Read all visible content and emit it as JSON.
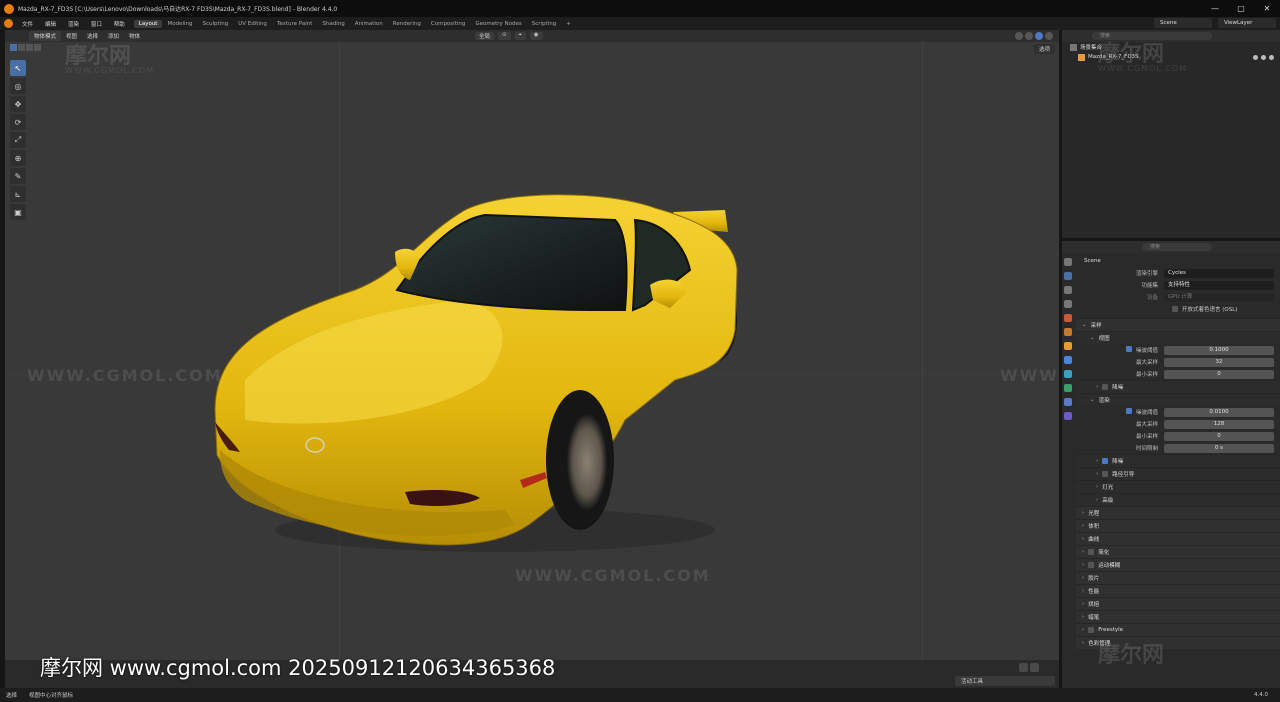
{
  "window": {
    "title": "Mazda_RX-7_FD3S [C:\\Users\\Lenovo\\Downloads\\马自达RX-7 FD3S\\Mazda_RX-7_FD3S.blend] - Blender 4.4.0",
    "min": "—",
    "max": "▢",
    "close": "✕"
  },
  "menu": [
    "文件",
    "编辑",
    "渲染",
    "窗口",
    "帮助"
  ],
  "workspaces": [
    "Layout",
    "Modeling",
    "Sculpting",
    "UV Editing",
    "Texture Paint",
    "Shading",
    "Animation",
    "Rendering",
    "Compositing",
    "Geometry Nodes",
    "Scripting",
    "+"
  ],
  "topright": {
    "scene": "Scene",
    "view_layer": "ViewLayer"
  },
  "viewport": {
    "mode": "物体模式",
    "menus": [
      "视图",
      "选择",
      "添加",
      "物体"
    ],
    "transform": "全局",
    "view_options": "选项"
  },
  "tools": [
    "↖",
    "◎",
    "✥",
    "⟳",
    "⤢",
    "⊕",
    "✎",
    "⊾",
    "▣"
  ],
  "watermarks": {
    "cn": "摩尔网",
    "url": "WWW.CGMOL.COM"
  },
  "overlay_text": "摩尔网 www.cgmol.com 20250912120634365368",
  "timeline": {
    "active_tool": "活动工具"
  },
  "status": {
    "select": "选择",
    "center": "视图中心对齐鼠标",
    "version": "4.4.0"
  },
  "outliner": {
    "search": "搜索",
    "collection": "场景集合",
    "object": "Mazda_RX-7_FD3S"
  },
  "properties": {
    "search": "搜索",
    "scene": "Scene",
    "render_engine_label": "渲染引擎",
    "render_engine": "Cycles",
    "feature_set_label": "功能集",
    "feature_set": "支持特性",
    "device_label": "设备",
    "device": "GPU 计算",
    "osl": "开放式着色语言 (OSL)",
    "sampling": "采样",
    "viewport": "视图",
    "noise_threshold_label": "噪波阈值",
    "vp_noise": "0.1000",
    "max_samples_label": "最大采样",
    "vp_max": "32",
    "min_samples_label": "最小采样",
    "vp_min": "0",
    "denoise": "降噪",
    "render": "渲染",
    "r_noise": "0.0100",
    "r_max": "128",
    "r_min": "0",
    "time_limit_label": "时间限制",
    "r_time": "0 s",
    "r_denoise": "降噪",
    "path_guiding": "路径引导",
    "lights": "灯光",
    "advanced": "高级",
    "sections": [
      "光程",
      "体积",
      "曲线",
      "简化",
      "运动模糊",
      "胶片",
      "性能",
      "烘焙",
      "蜡笔",
      "Freestyle",
      "色彩管理"
    ]
  }
}
